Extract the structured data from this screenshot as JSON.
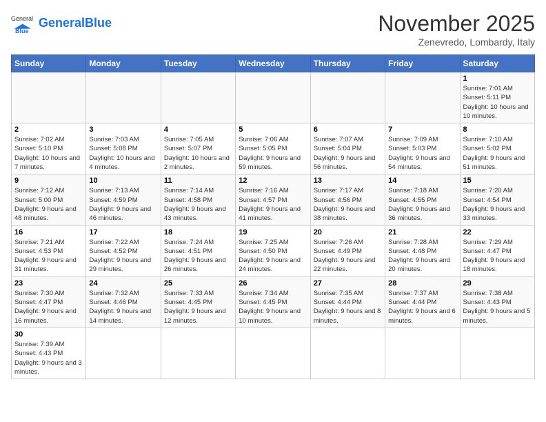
{
  "header": {
    "logo_general": "General",
    "logo_blue": "Blue",
    "month_year": "November 2025",
    "location": "Zenevredo, Lombardy, Italy"
  },
  "weekdays": [
    "Sunday",
    "Monday",
    "Tuesday",
    "Wednesday",
    "Thursday",
    "Friday",
    "Saturday"
  ],
  "weeks": [
    [
      {
        "day": "",
        "info": ""
      },
      {
        "day": "",
        "info": ""
      },
      {
        "day": "",
        "info": ""
      },
      {
        "day": "",
        "info": ""
      },
      {
        "day": "",
        "info": ""
      },
      {
        "day": "",
        "info": ""
      },
      {
        "day": "1",
        "info": "Sunrise: 7:01 AM\nSunset: 5:11 PM\nDaylight: 10 hours and 10 minutes."
      }
    ],
    [
      {
        "day": "2",
        "info": "Sunrise: 7:02 AM\nSunset: 5:10 PM\nDaylight: 10 hours and 7 minutes."
      },
      {
        "day": "3",
        "info": "Sunrise: 7:03 AM\nSunset: 5:08 PM\nDaylight: 10 hours and 4 minutes."
      },
      {
        "day": "4",
        "info": "Sunrise: 7:05 AM\nSunset: 5:07 PM\nDaylight: 10 hours and 2 minutes."
      },
      {
        "day": "5",
        "info": "Sunrise: 7:06 AM\nSunset: 5:05 PM\nDaylight: 9 hours and 59 minutes."
      },
      {
        "day": "6",
        "info": "Sunrise: 7:07 AM\nSunset: 5:04 PM\nDaylight: 9 hours and 56 minutes."
      },
      {
        "day": "7",
        "info": "Sunrise: 7:09 AM\nSunset: 5:03 PM\nDaylight: 9 hours and 54 minutes."
      },
      {
        "day": "8",
        "info": "Sunrise: 7:10 AM\nSunset: 5:02 PM\nDaylight: 9 hours and 51 minutes."
      }
    ],
    [
      {
        "day": "9",
        "info": "Sunrise: 7:12 AM\nSunset: 5:00 PM\nDaylight: 9 hours and 48 minutes."
      },
      {
        "day": "10",
        "info": "Sunrise: 7:13 AM\nSunset: 4:59 PM\nDaylight: 9 hours and 46 minutes."
      },
      {
        "day": "11",
        "info": "Sunrise: 7:14 AM\nSunset: 4:58 PM\nDaylight: 9 hours and 43 minutes."
      },
      {
        "day": "12",
        "info": "Sunrise: 7:16 AM\nSunset: 4:57 PM\nDaylight: 9 hours and 41 minutes."
      },
      {
        "day": "13",
        "info": "Sunrise: 7:17 AM\nSunset: 4:56 PM\nDaylight: 9 hours and 38 minutes."
      },
      {
        "day": "14",
        "info": "Sunrise: 7:18 AM\nSunset: 4:55 PM\nDaylight: 9 hours and 36 minutes."
      },
      {
        "day": "15",
        "info": "Sunrise: 7:20 AM\nSunset: 4:54 PM\nDaylight: 9 hours and 33 minutes."
      }
    ],
    [
      {
        "day": "16",
        "info": "Sunrise: 7:21 AM\nSunset: 4:53 PM\nDaylight: 9 hours and 31 minutes."
      },
      {
        "day": "17",
        "info": "Sunrise: 7:22 AM\nSunset: 4:52 PM\nDaylight: 9 hours and 29 minutes."
      },
      {
        "day": "18",
        "info": "Sunrise: 7:24 AM\nSunset: 4:51 PM\nDaylight: 9 hours and 26 minutes."
      },
      {
        "day": "19",
        "info": "Sunrise: 7:25 AM\nSunset: 4:50 PM\nDaylight: 9 hours and 24 minutes."
      },
      {
        "day": "20",
        "info": "Sunrise: 7:26 AM\nSunset: 4:49 PM\nDaylight: 9 hours and 22 minutes."
      },
      {
        "day": "21",
        "info": "Sunrise: 7:28 AM\nSunset: 4:48 PM\nDaylight: 9 hours and 20 minutes."
      },
      {
        "day": "22",
        "info": "Sunrise: 7:29 AM\nSunset: 4:47 PM\nDaylight: 9 hours and 18 minutes."
      }
    ],
    [
      {
        "day": "23",
        "info": "Sunrise: 7:30 AM\nSunset: 4:47 PM\nDaylight: 9 hours and 16 minutes."
      },
      {
        "day": "24",
        "info": "Sunrise: 7:32 AM\nSunset: 4:46 PM\nDaylight: 9 hours and 14 minutes."
      },
      {
        "day": "25",
        "info": "Sunrise: 7:33 AM\nSunset: 4:45 PM\nDaylight: 9 hours and 12 minutes."
      },
      {
        "day": "26",
        "info": "Sunrise: 7:34 AM\nSunset: 4:45 PM\nDaylight: 9 hours and 10 minutes."
      },
      {
        "day": "27",
        "info": "Sunrise: 7:35 AM\nSunset: 4:44 PM\nDaylight: 9 hours and 8 minutes."
      },
      {
        "day": "28",
        "info": "Sunrise: 7:37 AM\nSunset: 4:44 PM\nDaylight: 9 hours and 6 minutes."
      },
      {
        "day": "29",
        "info": "Sunrise: 7:38 AM\nSunset: 4:43 PM\nDaylight: 9 hours and 5 minutes."
      }
    ],
    [
      {
        "day": "30",
        "info": "Sunrise: 7:39 AM\nSunset: 4:43 PM\nDaylight: 9 hours and 3 minutes."
      },
      {
        "day": "",
        "info": ""
      },
      {
        "day": "",
        "info": ""
      },
      {
        "day": "",
        "info": ""
      },
      {
        "day": "",
        "info": ""
      },
      {
        "day": "",
        "info": ""
      },
      {
        "day": "",
        "info": ""
      }
    ]
  ]
}
